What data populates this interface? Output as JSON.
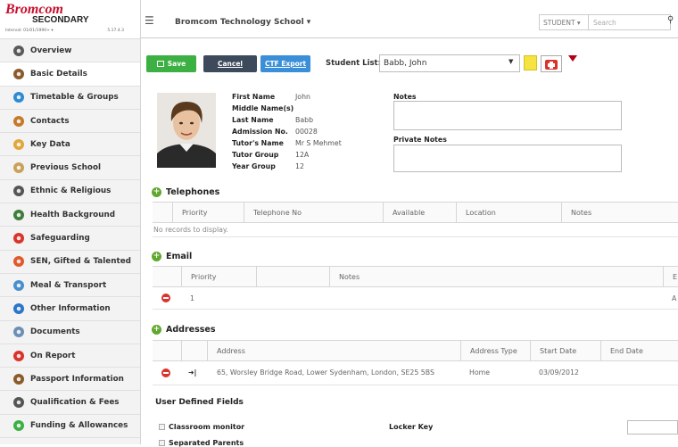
{
  "app": {
    "brand": "Bromcom",
    "edition": "SECONDARY",
    "session": "Interval: 01/01/1990+ ▾",
    "version": "5.17.4.3"
  },
  "topbar": {
    "school": "Bromcom Technology School ▾",
    "role": "STUDENT ▾",
    "search_placeholder": "Search"
  },
  "sidebar": {
    "items": [
      {
        "label": "Overview",
        "icon": "users-icon"
      },
      {
        "label": "Basic Details",
        "icon": "person-icon",
        "active": true
      },
      {
        "label": "Timetable & Groups",
        "icon": "clock-icon"
      },
      {
        "label": "Contacts",
        "icon": "contacts-icon"
      },
      {
        "label": "Key Data",
        "icon": "key-icon"
      },
      {
        "label": "Previous School",
        "icon": "school-icon"
      },
      {
        "label": "Ethnic & Religious",
        "icon": "people-icon"
      },
      {
        "label": "Health Background",
        "icon": "health-icon"
      },
      {
        "label": "Safeguarding",
        "icon": "shield-icon"
      },
      {
        "label": "SEN, Gifted & Talented",
        "icon": "lifebuoy-icon"
      },
      {
        "label": "Meal & Transport",
        "icon": "bus-icon"
      },
      {
        "label": "Other Information",
        "icon": "info-icon"
      },
      {
        "label": "Documents",
        "icon": "document-icon"
      },
      {
        "label": "On Report",
        "icon": "report-icon"
      },
      {
        "label": "Passport Information",
        "icon": "passport-icon"
      },
      {
        "label": "Qualification & Fees",
        "icon": "graduation-icon"
      },
      {
        "label": "Funding & Allowances",
        "icon": "coins-icon"
      }
    ]
  },
  "toolbar": {
    "save": "Save",
    "cancel": "Cancel",
    "ctf_export": "CTF Export",
    "student_list_label": "Student List:",
    "student_list_value": "Babb, John"
  },
  "details": {
    "labels": [
      "First Name",
      "Middle Name(s)",
      "Last Name",
      "Admission No.",
      "Tutor's Name",
      "Tutor Group",
      "Year Group"
    ],
    "values": [
      "John",
      "",
      "Babb",
      "00028",
      "Mr S Mehmet",
      "12A",
      "12"
    ],
    "notes_label": "Notes",
    "private_notes_label": "Private Notes"
  },
  "telephones": {
    "title": "Telephones",
    "columns": [
      "Priority",
      "Telephone No",
      "Available",
      "Location",
      "Notes"
    ],
    "empty": "No records to display."
  },
  "email": {
    "title": "Email",
    "columns": [
      "Priority",
      "Notes",
      "E"
    ],
    "rows": [
      {
        "priority": "1",
        "tail": "A"
      }
    ]
  },
  "addresses": {
    "title": "Addresses",
    "columns": [
      "Address",
      "Address Type",
      "Start Date",
      "End Date"
    ],
    "rows": [
      {
        "address": "65, Worsley Bridge Road, Lower Sydenham, London, SE25 5BS",
        "type": "Home",
        "start": "03/09/2012",
        "end": ""
      }
    ]
  },
  "user_defined": {
    "title": "User Defined Fields",
    "checkbox1": "Classroom monitor",
    "checkbox2": "Separated Parents",
    "locker_label": "Locker Key"
  }
}
